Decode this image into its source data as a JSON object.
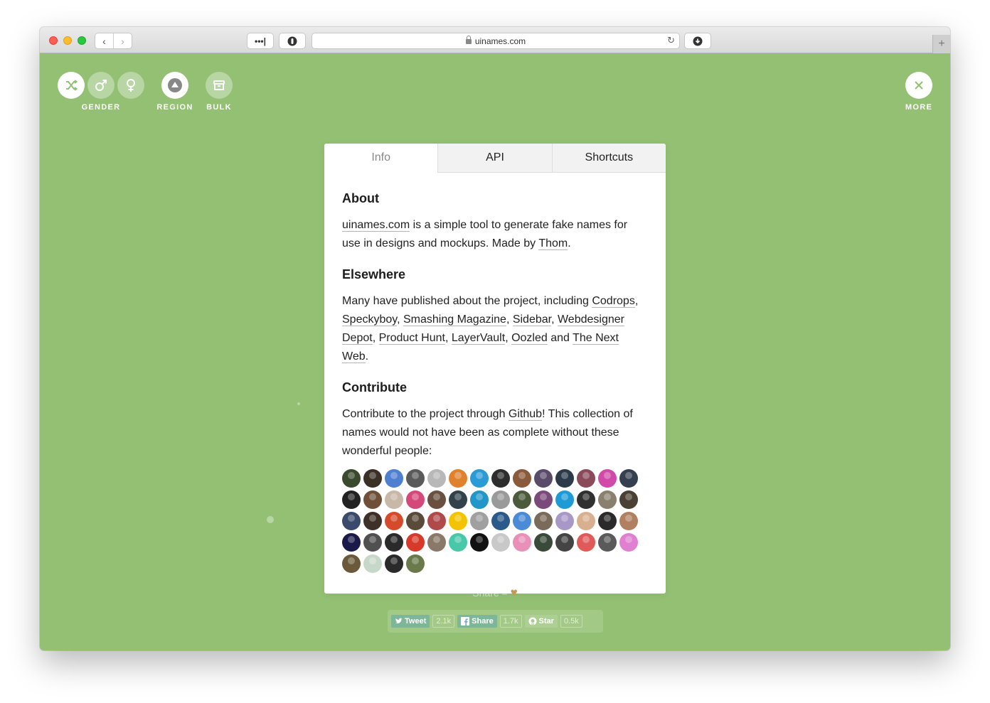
{
  "browser": {
    "url": "uinames.com",
    "more_dots": "•••|",
    "back_glyph": "‹",
    "forward_glyph": "›",
    "reload_glyph": "↻",
    "newtab_glyph": "+"
  },
  "controls": {
    "gender_label": "GENDER",
    "region_label": "REGION",
    "bulk_label": "BULK",
    "more_label": "MORE"
  },
  "modal": {
    "tabs": [
      "Info",
      "API",
      "Shortcuts"
    ],
    "active_tab": "Info",
    "about": {
      "heading": "About",
      "link_site": "uinames.com",
      "text1": " is a simple tool to generate fake names for use in designs and mockups. Made by ",
      "link_author": "Thom",
      "text_end": "."
    },
    "elsewhere": {
      "heading": "Elsewhere",
      "intro": "Many have published about the project, including ",
      "links": [
        "Codrops",
        "Speckyboy",
        "Smashing Magazine",
        "Sidebar",
        "Webdesigner Depot",
        "Product Hunt",
        "LayerVault",
        "Oozled",
        "The Next Web"
      ],
      "sep": ", ",
      "and": " and ",
      "end": "."
    },
    "contribute": {
      "heading": "Contribute",
      "text1": "Contribute to the project through ",
      "link": "Github",
      "text2": "! This collection of names would not have been as complete without these wonderful people:"
    },
    "avatar_colors": [
      "#3b4a2c",
      "#3a3026",
      "#4e7fd1",
      "#5a5a5a",
      "#b8b8b8",
      "#e0822c",
      "#2b9bd6",
      "#2d2d2d",
      "#8a5a3a",
      "#5b4b6b",
      "#2c3a4a",
      "#8a4a5a",
      "#d14aa8",
      "#34404f",
      "#222222",
      "#6e5038",
      "#c8b8a8",
      "#d4487a",
      "#6a5040",
      "#32424a",
      "#2196c8",
      "#9a9a9a",
      "#4a5a3a",
      "#7a4a7a",
      "#1e9ad6",
      "#303030",
      "#8a8070",
      "#4a4034",
      "#3a4a6a",
      "#3c3028",
      "#d44a2a",
      "#5a4a3a",
      "#b04a4a",
      "#f5c400",
      "#a0a0a0",
      "#2a5a8a",
      "#4a8ad6",
      "#7a6a5a",
      "#a898c8",
      "#d8b090",
      "#2a2a2a",
      "#b08060",
      "#1a1a4a",
      "#505050",
      "#2a2a2a",
      "#d83a2a",
      "#8a7868",
      "#48c8a8",
      "#111111",
      "#c8c8c8",
      "#e890b8",
      "#3a4a3a",
      "#444444",
      "#e05a5a",
      "#5a5a5a",
      "#e080d0",
      "#6a5a3a",
      "#c8d8c8",
      "#2a2a2a",
      "#6a7a4a"
    ]
  },
  "share": {
    "label": "Share = ",
    "heart": "♥",
    "tweet": "Tweet",
    "tweet_count": "2.1k",
    "fb_share": "Share",
    "fb_count": "1.7k",
    "star": "Star",
    "star_count": "0.5k"
  }
}
